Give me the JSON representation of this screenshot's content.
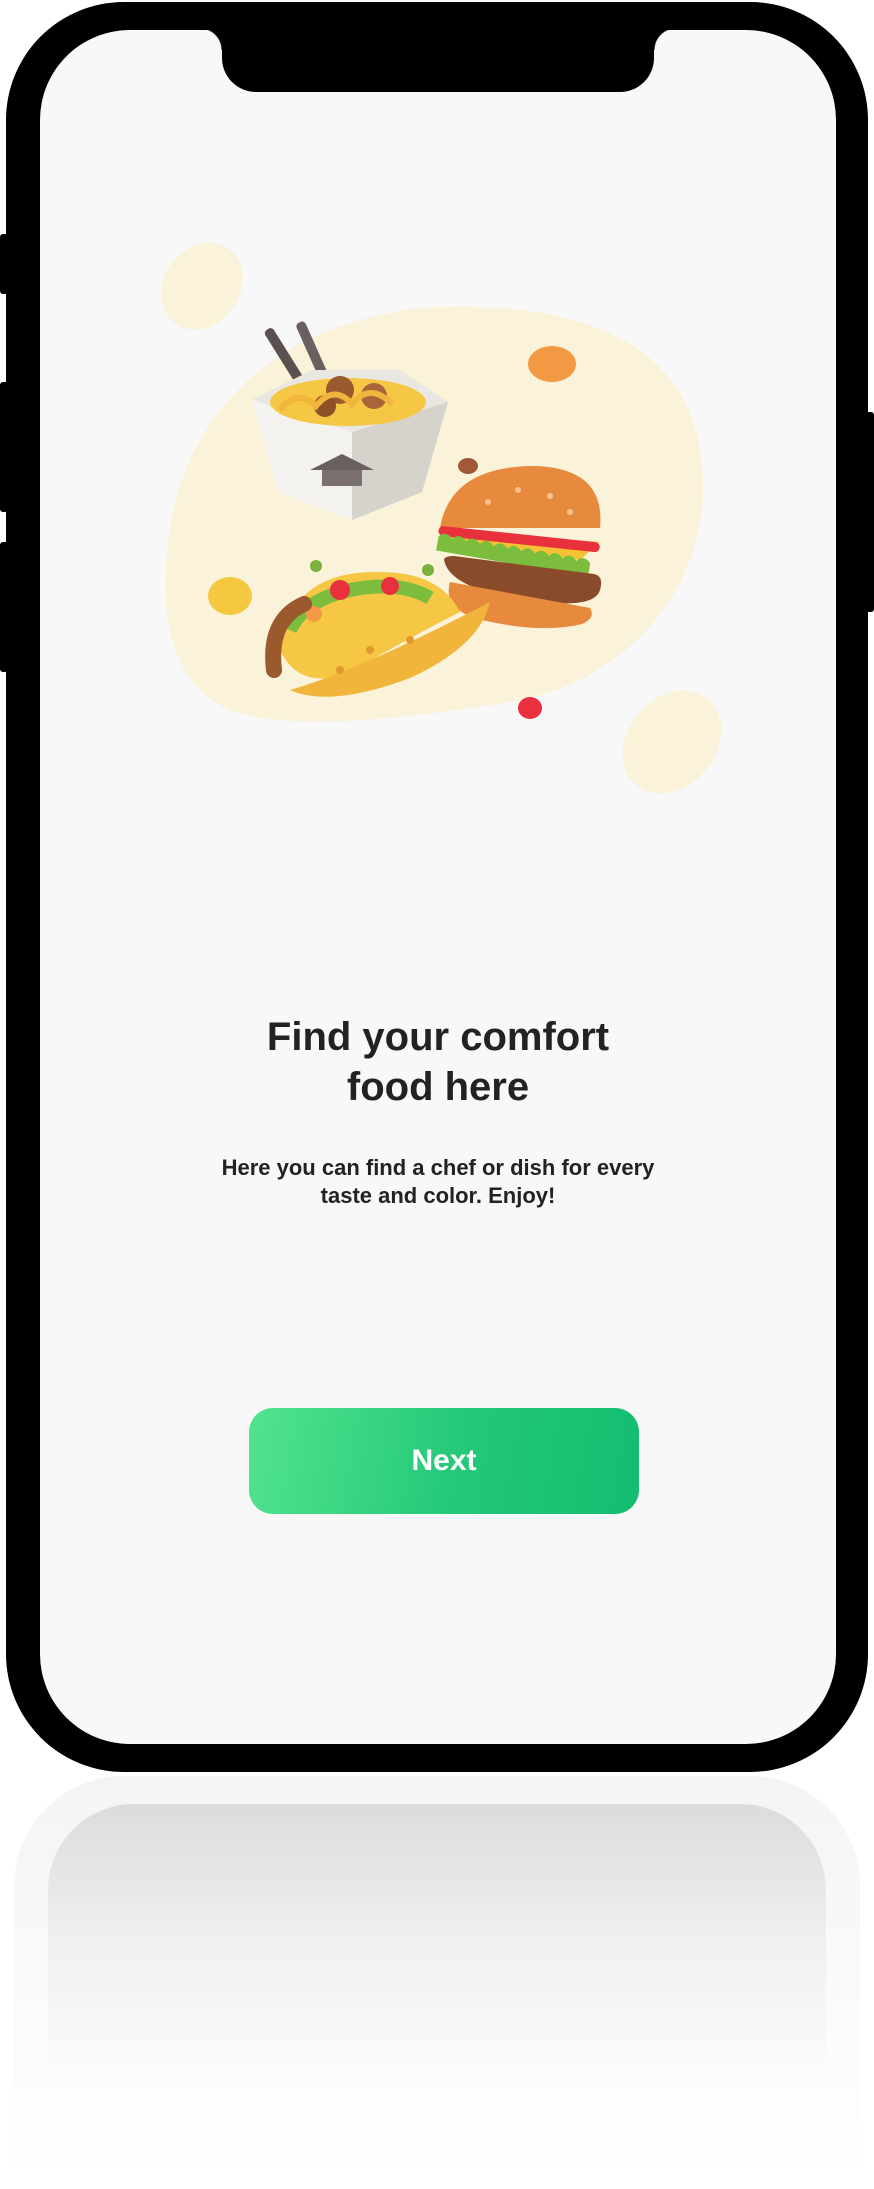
{
  "onboarding": {
    "title_lines": [
      "Find your comfort",
      "food here"
    ],
    "subtitle_lines": [
      "Here you can find a chef or dish for every",
      "taste and color. Enjoy!"
    ],
    "next_label": "Next"
  },
  "illustration": {
    "items": [
      "noodle-box",
      "burger",
      "taco"
    ],
    "colors": {
      "blob": "#faf2d9",
      "button_start": "#52e38e",
      "button_end": "#13bd6f"
    }
  }
}
